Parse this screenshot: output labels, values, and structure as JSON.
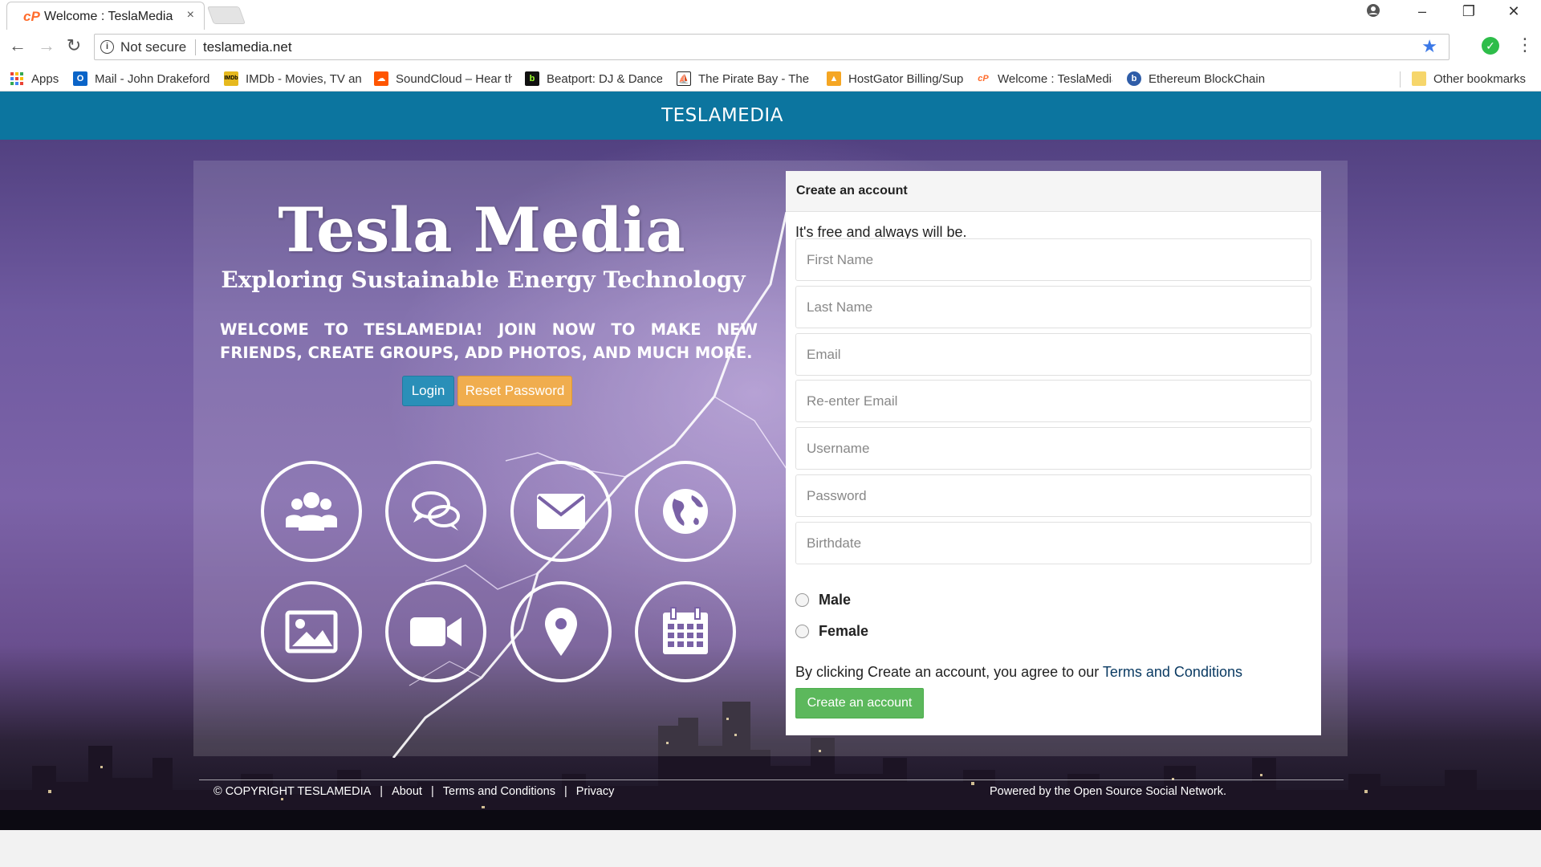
{
  "browser": {
    "tab": {
      "title": "Welcome : TeslaMedia",
      "favicon": "cP",
      "close": "×"
    },
    "address": {
      "security_label": "Not secure",
      "url": "teslamedia.net"
    },
    "bookmarks": [
      {
        "label": "Apps"
      },
      {
        "label": "Mail - John Drakeford"
      },
      {
        "label": "IMDb - Movies, TV and"
      },
      {
        "label": "SoundCloud – Hear the"
      },
      {
        "label": "Beatport: DJ & Dance"
      },
      {
        "label": "The Pirate Bay - The"
      },
      {
        "label": "HostGator Billing/Sup"
      },
      {
        "label": "Welcome : TeslaMedia"
      },
      {
        "label": "Ethereum BlockChain"
      },
      {
        "label": "Other bookmarks"
      }
    ]
  },
  "site": {
    "brand": "TESLAMEDIA",
    "hero_title": "Tesla Media",
    "hero_subtitle": "Exploring Sustainable Energy  Technology",
    "welcome": "WELCOME TO TESLAMEDIA! JOIN NOW TO MAKE NEW FRIENDS, CREATE GROUPS, ADD PHOTOS, AND MUCH MORE.",
    "login_label": "Login",
    "reset_label": "Reset Password",
    "feature_icons": [
      "users-icon",
      "chat-icon",
      "envelope-icon",
      "globe-icon",
      "image-icon",
      "video-camera-icon",
      "map-pin-icon",
      "calendar-icon"
    ]
  },
  "signup": {
    "heading": "Create an account",
    "tagline": "It's free and always will be.",
    "fields": {
      "first_name": "First Name",
      "last_name": "Last Name",
      "email": "Email",
      "email_confirm": "Re-enter Email",
      "username": "Username",
      "password": "Password",
      "birthdate": "Birthdate"
    },
    "gender": {
      "male": "Male",
      "female": "Female"
    },
    "terms_prefix": "By clicking Create an account, you agree to our ",
    "terms_link": "Terms and Conditions",
    "submit": "Create an account"
  },
  "footer": {
    "copyright": "© COPYRIGHT TESLAMEDIA",
    "links": [
      "About",
      "Terms and Conditions",
      "Privacy"
    ],
    "separator": "|",
    "powered": "Powered by the Open Source Social Network."
  },
  "colors": {
    "topbar": "#0c759f",
    "login": "#2a8fb8",
    "reset": "#f0ad4e",
    "create": "#5cb85c"
  }
}
